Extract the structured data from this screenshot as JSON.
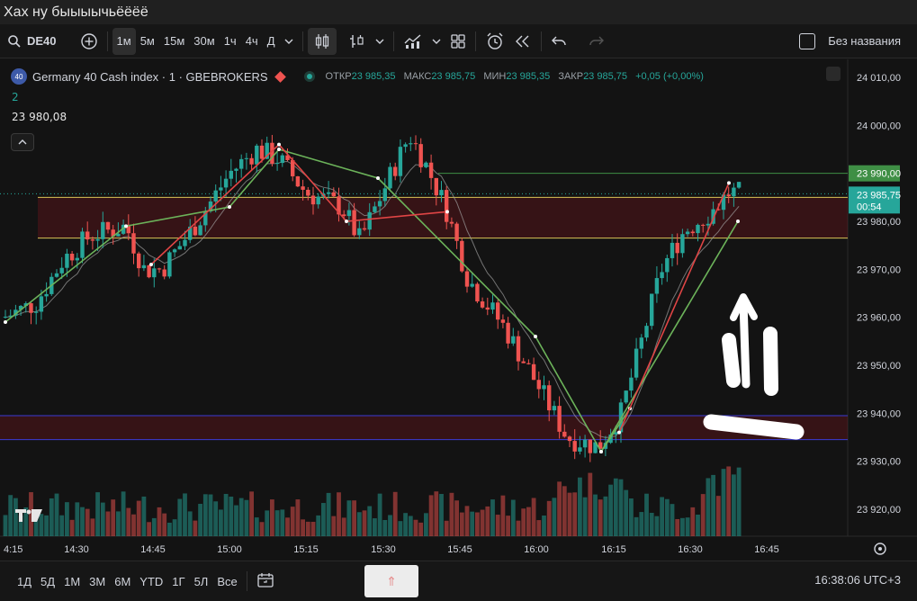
{
  "window": {
    "title": "Хах ну быыыычьёёёё"
  },
  "toolbar": {
    "symbol": "DE40",
    "intervals": [
      "1м",
      "5м",
      "15м",
      "30м",
      "1ч",
      "4ч",
      "Д"
    ],
    "active_interval": "1м",
    "layout_name": "Без названия"
  },
  "legend": {
    "badge": "40",
    "title": "Germany 40 Cash index · 1 · GBEBROKERS",
    "open_label": "ОТКР",
    "open": "23 985,35",
    "high_label": "МАКС",
    "high": "23 985,75",
    "low_label": "МИН",
    "low": "23 985,35",
    "close_label": "ЗАКР",
    "close": "23 985,75",
    "change": "+0,05 (+0,00%)",
    "indicator_value": "2",
    "price_line": "23 980,08"
  },
  "chart_data": {
    "type": "candlestick",
    "y_ticks": [
      "24 010,00",
      "24 000,00",
      "23 990,00",
      "23 980,00",
      "23 970,00",
      "23 960,00",
      "23 950,00",
      "23 940,00",
      "23 930,00",
      "23 920,00"
    ],
    "y_tick_values": [
      24010,
      24000,
      23990,
      23980,
      23970,
      23960,
      23950,
      23940,
      23930,
      23920
    ],
    "x_ticks": [
      "4:15",
      "14:30",
      "14:45",
      "15:00",
      "15:15",
      "15:30",
      "15:45",
      "16:00",
      "16:15",
      "16:30",
      "16:45"
    ],
    "ylim": [
      23914,
      24013
    ],
    "current_price": "23 985,75",
    "current_countdown": "00:54",
    "current_price_value": 23985.75,
    "alert_price": "23 990,00",
    "alert_price_value": 23990,
    "resistance_zone": [
      23976.5,
      23985
    ],
    "support_zone": [
      23934.5,
      23939.5
    ],
    "colors": {
      "up": "#26a69a",
      "down": "#ef5350",
      "background": "#131313"
    }
  },
  "bottom_bar": {
    "ranges": [
      "1Д",
      "5Д",
      "1М",
      "3М",
      "6М",
      "YTD",
      "1Г",
      "5Л",
      "Все"
    ],
    "upload_glyph": "⇑",
    "clock": "16:38:06 UTC+3"
  }
}
